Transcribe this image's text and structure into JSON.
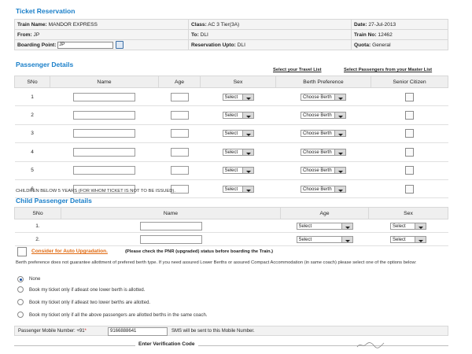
{
  "reservation": {
    "title": "Ticket Reservation",
    "train_name_label": "Train Name:",
    "train_name": "MANDOR EXPRESS",
    "class_label": "Class:",
    "class_value": "AC 3 Tier(3A)",
    "date_label": "Date:",
    "date_value": "27-Jul-2013",
    "from_label": "From:",
    "from_value": "JP",
    "to_label": "To:",
    "to_value": "DLI",
    "train_no_label": "Train No:",
    "train_no_value": "12462",
    "boarding_label": "Boarding Point:",
    "boarding_value": "JP",
    "upto_label": "Reservation Upto:",
    "upto_value": "DLI",
    "quota_label": "Quota:",
    "quota_value": "General"
  },
  "passenger": {
    "title": "Passenger Details",
    "travel_list_link": "Select your Travel List",
    "master_list_link": "Select Passengers from your Master List",
    "headers": [
      "SNo",
      "Name",
      "Age",
      "Sex",
      "Berth Preference",
      "Senior Citizen"
    ],
    "rows": [
      {
        "sno": "1",
        "sex": "Select",
        "berth": "Choose Berth"
      },
      {
        "sno": "2",
        "sex": "Select",
        "berth": "Choose Berth"
      },
      {
        "sno": "3",
        "sex": "Select",
        "berth": "Choose Berth"
      },
      {
        "sno": "4",
        "sex": "Select",
        "berth": "Choose Berth"
      },
      {
        "sno": "5",
        "sex": "Select",
        "berth": "Choose Berth"
      },
      {
        "sno": "6",
        "sex": "Select",
        "berth": "Choose Berth"
      }
    ],
    "children_note": "CHILDREN BELOW 5 YEARS (FOR WHOM TICKET IS NOT TO BE ISSUED)."
  },
  "child": {
    "title": "Child Passenger Details",
    "headers": [
      "SNo",
      "Name",
      "Age",
      "Sex"
    ],
    "rows": [
      {
        "sno": "1.",
        "age": "Select",
        "sex": "Select"
      },
      {
        "sno": "2.",
        "age": "Select",
        "sex": "Select"
      }
    ]
  },
  "upgrade": {
    "link": "Consider for Auto Upgradation.",
    "note": "(Please check the PNR (upgraded) status before boarding the Train.)"
  },
  "berth_note": "Berth preference does not guarantee allottment of prefered berth type. If you need assured Lower Berths or assured Compact Accommodation (in same coach) please select one of the options below:",
  "options": [
    "None",
    "Book my ticket only if atleast one lower berth is allotted.",
    "Book my ticket only if atleast two lower berths are allotted.",
    "Book my ticket only if all the above passengers are allotted berths in the same coach."
  ],
  "mobile": {
    "label": "Passenger Mobile Number: +91",
    "required": "*",
    "value": "9166888641",
    "note": "SMS will be sent to this Mobile Number."
  },
  "verification": {
    "label": "Enter Verification Code"
  }
}
